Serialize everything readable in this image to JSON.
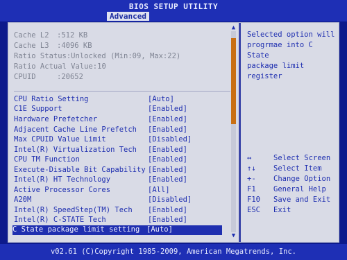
{
  "header": {
    "title": "BIOS SETUP UTILITY",
    "active_tab": "Advanced"
  },
  "info": [
    {
      "label": "Cache L2",
      "value": ":512 KB"
    },
    {
      "label": "Cache L3",
      "value": ":4096 KB"
    },
    {
      "label": "Ratio Status",
      "value": ":Unlocked (Min:09, Max:22)"
    },
    {
      "label": "Ratio Actual Value",
      "value": ":10"
    },
    {
      "label": "CPUID",
      "value": ":20652"
    }
  ],
  "options": [
    {
      "name": "CPU Ratio Setting",
      "value": "[Auto]"
    },
    {
      "name": "C1E Support",
      "value": "[Enabled]"
    },
    {
      "name": "Hardware Prefetcher",
      "value": "[Enabled]"
    },
    {
      "name": "Adjacent Cache Line Prefetch",
      "value": "[Enabled]"
    },
    {
      "name": "Max CPUID Value Limit",
      "value": "[Disabled]"
    },
    {
      "name": "Intel(R) Virtualization Tech",
      "value": "[Enabled]"
    },
    {
      "name": "CPU TM Function",
      "value": "[Enabled]"
    },
    {
      "name": "Execute-Disable Bit Capability",
      "value": "[Enabled]"
    },
    {
      "name": "Intel(R) HT Technology",
      "value": "[Enabled]"
    },
    {
      "name": "Active Processor Cores",
      "value": "[All]"
    },
    {
      "name": "A20M",
      "value": "[Disabled]"
    },
    {
      "name": "Intel(R) SpeedStep(TM) Tech",
      "value": "[Enabled]"
    },
    {
      "name": "Intel(R) C-STATE Tech",
      "value": "[Enabled]"
    },
    {
      "name": "C State package limit setting",
      "value": "[Auto]"
    }
  ],
  "selected_option": "C State package limit setting",
  "help_text": "Selected option will\nprogrmae into C State\npackage limit register",
  "keys": [
    {
      "key": "↔",
      "desc": "Select Screen"
    },
    {
      "key": "↑↓",
      "desc": "Select Item"
    },
    {
      "key": "+-",
      "desc": "Change Option"
    },
    {
      "key": "F1",
      "desc": "General Help"
    },
    {
      "key": "F10",
      "desc": "Save and Exit"
    },
    {
      "key": "ESC",
      "desc": "Exit"
    }
  ],
  "footer": "v02.61 (C)Copyright 1985-2009, American Megatrends, Inc."
}
